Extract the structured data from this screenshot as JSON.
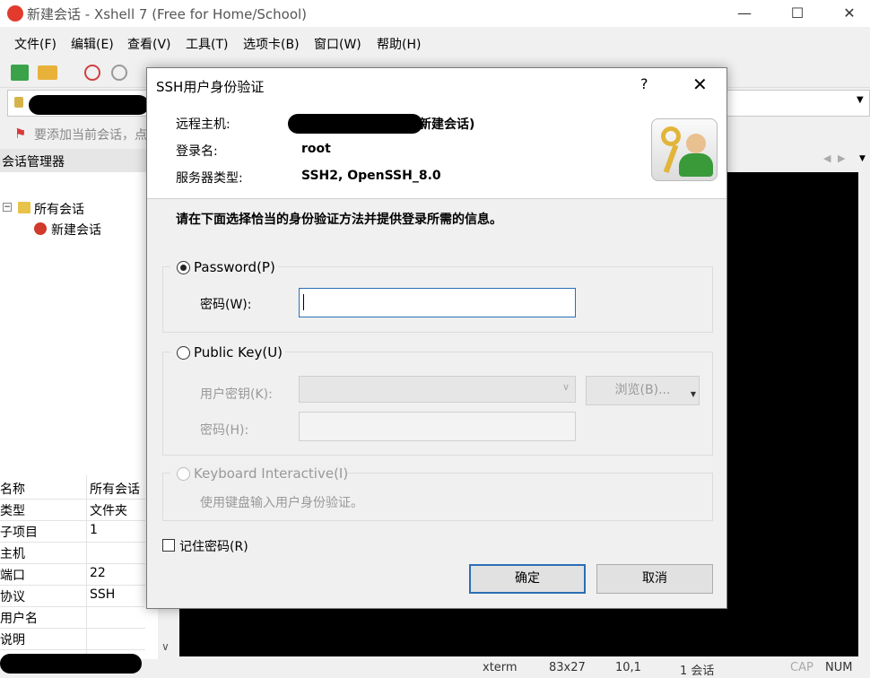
{
  "app": {
    "title": "新建会话 - Xshell 7 (Free for Home/School)",
    "window_controls": {
      "minimize": "—",
      "maximize": "☐",
      "close": "✕"
    }
  },
  "menu": [
    "文件(F)",
    "编辑(E)",
    "查看(V)",
    "工具(T)",
    "选项卡(B)",
    "窗口(W)",
    "帮助(H)"
  ],
  "hint": "要添加当前会话，点",
  "session_manager": {
    "title": "会话管理器",
    "tree_root": "所有会话",
    "tree_child": "新建会话"
  },
  "properties": [
    {
      "key": "名称",
      "value": "所有会话"
    },
    {
      "key": "类型",
      "value": "文件夹"
    },
    {
      "key": "子项目",
      "value": "1"
    },
    {
      "key": "主机",
      "value": ""
    },
    {
      "key": "端口",
      "value": "22"
    },
    {
      "key": "协议",
      "value": "SSH"
    },
    {
      "key": "用户名",
      "value": ""
    },
    {
      "key": "说明",
      "value": ""
    }
  ],
  "status": {
    "term": "xterm",
    "size": "83x27",
    "pos": "10,1",
    "sessions": "1 会话",
    "cap": "CAP",
    "num": "NUM"
  },
  "dialog": {
    "title": "SSH用户身份验证",
    "help": "?",
    "close": "✕",
    "remote_host_label": "远程主机:",
    "remote_host_value": "新建会话)",
    "login_label": "登录名:",
    "login_value": "root",
    "server_type_label": "服务器类型:",
    "server_type_value": "SSH2, OpenSSH_8.0",
    "instruction": "请在下面选择恰当的身份验证方法并提供登录所需的信息。",
    "password_option": "Password(P)",
    "password_field_label": "密码(W):",
    "password_value": "",
    "publickey_option": "Public Key(U)",
    "user_key_label": "用户密钥(K):",
    "browse_label": "浏览(B)...",
    "key_password_label": "密码(H):",
    "keyboard_option": "Keyboard Interactive(I)",
    "keyboard_desc": "使用键盘输入用户身份验证。",
    "remember_label": "记住密码(R)",
    "ok_label": "确定",
    "cancel_label": "取消",
    "selected_method": "Password"
  },
  "colors": {
    "accent": "#2a6fb5",
    "terminal_bg": "#000000"
  }
}
